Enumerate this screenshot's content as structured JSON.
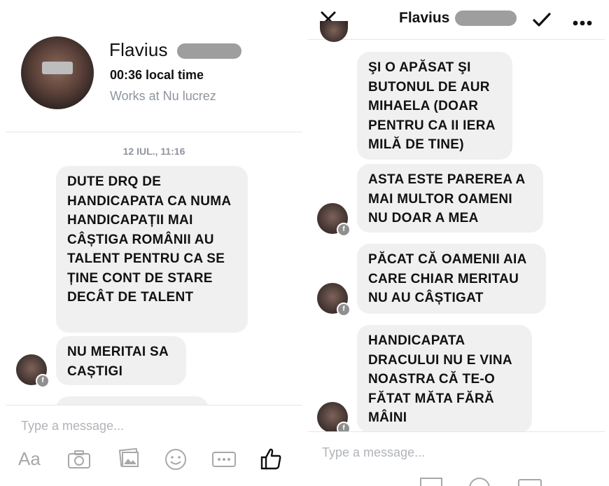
{
  "left": {
    "contact_name": "Flavius",
    "local_time": "00:36 local time",
    "works_at": "Works at Nu lucrez",
    "timestamp": "12 IUL., 11:16",
    "messages": [
      "DUTE DRQ DE HANDICAPATA CA NUMA HANDICAPAȚII MAI CÂȘTIGA ROMÂNII AU TALENT PENTRU CA SE ȚINE CONT DE STARE DECÂT DE TALENT",
      "NU MERITAI SA CAȘTIGI"
    ],
    "composer_placeholder": "Type a message...",
    "toolbar": {
      "text_label": "Aa"
    }
  },
  "right": {
    "contact_name": "Flavius",
    "messages": [
      "ŞI O APĂSAT ŞI BUTONUL DE AUR MIHAELA (DOAR PENTRU CA II IERA MILĂ DE TINE)",
      "ASTA ESTE PAREREA A MAI MULTOR OAMENI NU DOAR A MEA",
      "PĂCAT CĂ OAMENII AIA CARE CHIAR MERITAU NU AU CÂȘTIGAT",
      "HANDICAPATA DRACULUI NU E VINA NOASTRA CĂ TE-O FĂTAT MĂTA FĂRĂ MÂINI"
    ],
    "composer_placeholder": "Type a message..."
  },
  "icons": {
    "close": "close-icon",
    "check": "check-icon",
    "more": "more-icon",
    "camera": "camera-icon",
    "gallery": "gallery-icon",
    "emoji": "emoji-icon",
    "gif": "gif-icon",
    "like": "thumbs-up-icon"
  },
  "colors": {
    "bubble": "#f1f0f0",
    "placeholder": "#b0b3b8",
    "subtext": "#8d949e"
  }
}
